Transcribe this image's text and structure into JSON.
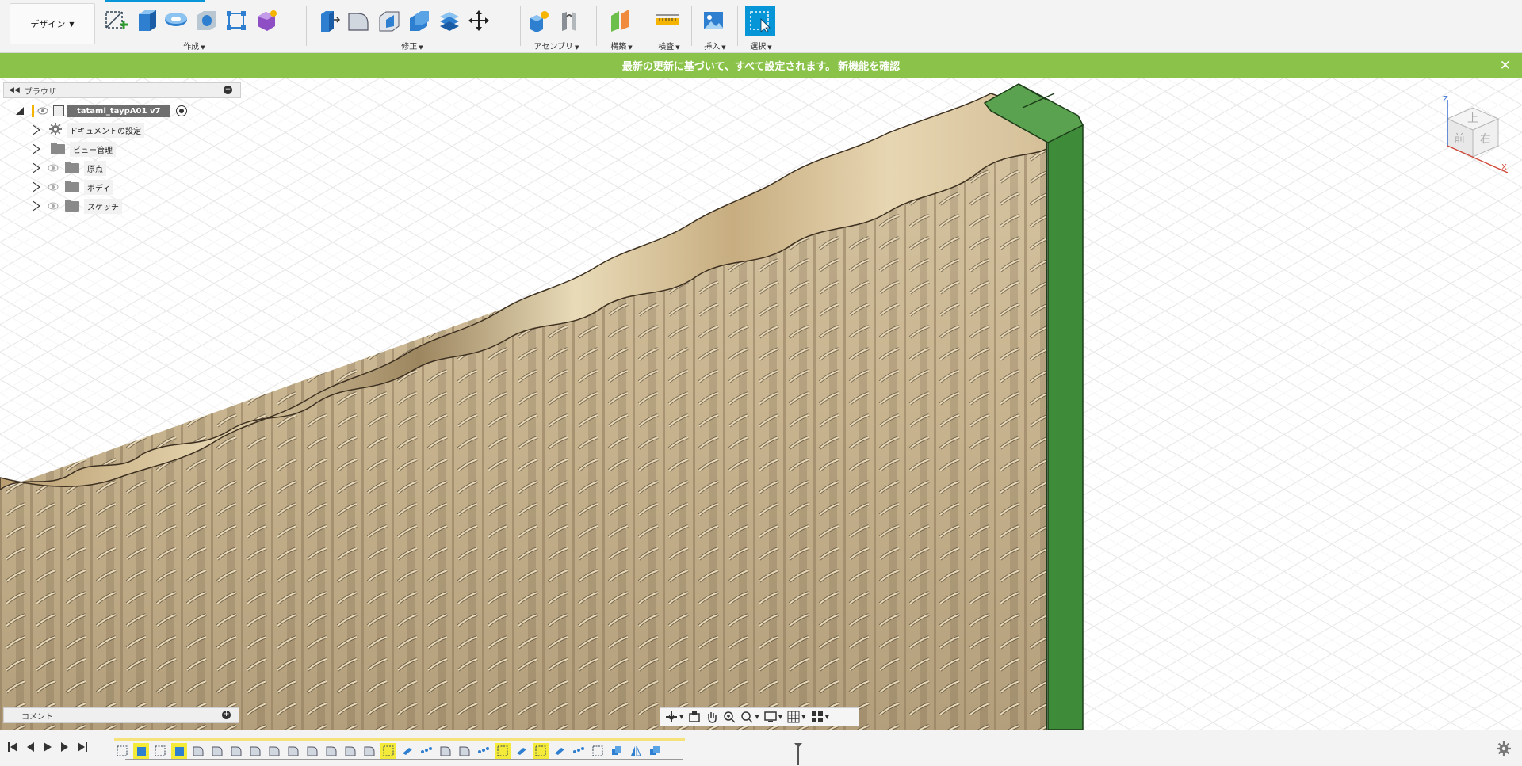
{
  "app": {
    "workspace_label": "デザイン"
  },
  "toolbar": {
    "groups": [
      {
        "label": "作成"
      },
      {
        "label": "修正"
      },
      {
        "label": "アセンブリ"
      },
      {
        "label": "構築"
      },
      {
        "label": "検査"
      },
      {
        "label": "挿入"
      },
      {
        "label": "選択"
      }
    ]
  },
  "notification": {
    "message": "最新の更新に基づいて、すべて設定されます。",
    "link": "新機能を確認"
  },
  "browser": {
    "title": "ブラウザ",
    "root": "tatami_taypA01 v7",
    "items": [
      {
        "label": "ドキュメントの設定",
        "icon": "gear-icon"
      },
      {
        "label": "ビュー管理",
        "icon": "folder-icon"
      },
      {
        "label": "原点",
        "icon": "folder-icon"
      },
      {
        "label": "ボディ",
        "icon": "folder-icon"
      },
      {
        "label": "スケッチ",
        "icon": "folder-icon"
      }
    ]
  },
  "comments": {
    "title": "コメント"
  },
  "viewcube": {
    "top": "上",
    "front": "前",
    "right": "右",
    "axis_z": "Z",
    "axis_x": "X"
  },
  "colors": {
    "accent": "#0696d7",
    "notice": "#8bc34a",
    "green_body": "#3e8b3a",
    "timeline_highlight": "#f3ea3a"
  }
}
